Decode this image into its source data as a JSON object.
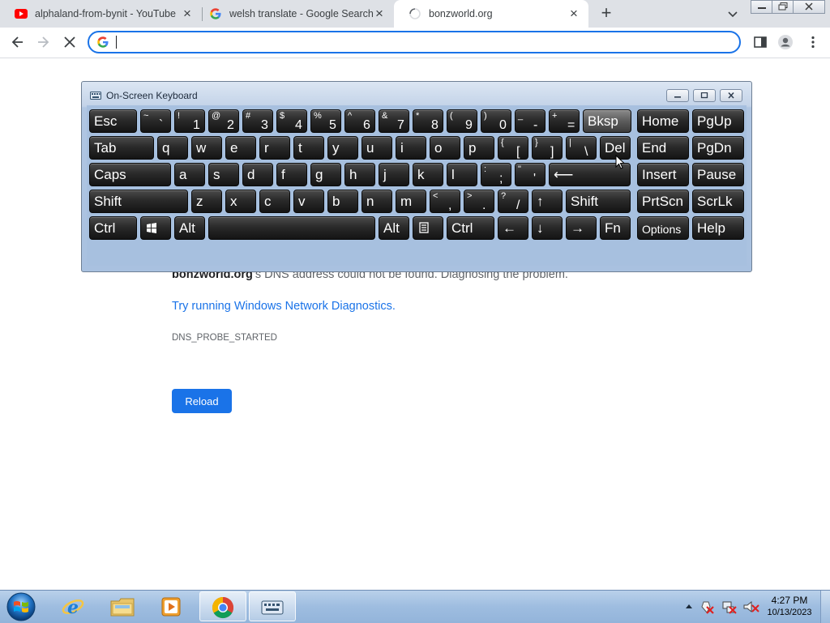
{
  "tabs": [
    {
      "title": "alphaland-from-bynit - YouTube",
      "favicon": "youtube-icon"
    },
    {
      "title": "welsh translate - Google Search",
      "favicon": "google-icon"
    },
    {
      "title": "bonzworld.org",
      "favicon": "loading-spinner-icon"
    }
  ],
  "omnibox": {
    "value": "",
    "placeholder": ""
  },
  "error_page": {
    "host": "bonzworld.org",
    "message": "’s DNS address could not be found. Diagnosing the problem.",
    "link": "Try running Windows Network Diagnostics.",
    "code": "DNS_PROBE_STARTED",
    "reload_label": "Reload"
  },
  "osk": {
    "title": "On-Screen Keyboard",
    "rows": [
      [
        {
          "label": "Esc"
        },
        {
          "shift": "~",
          "base": "`"
        },
        {
          "shift": "!",
          "base": "1"
        },
        {
          "shift": "@",
          "base": "2"
        },
        {
          "shift": "#",
          "base": "3"
        },
        {
          "shift": "$",
          "base": "4"
        },
        {
          "shift": "%",
          "base": "5"
        },
        {
          "shift": "^",
          "base": "6"
        },
        {
          "shift": "&",
          "base": "7"
        },
        {
          "shift": "*",
          "base": "8"
        },
        {
          "shift": "(",
          "base": "9"
        },
        {
          "shift": ")",
          "base": "0"
        },
        {
          "shift": "_",
          "base": "-"
        },
        {
          "shift": "+",
          "base": "="
        },
        {
          "label": "Bksp"
        },
        {
          "label": "Home"
        },
        {
          "label": "PgUp"
        }
      ],
      [
        {
          "label": "Tab"
        },
        {
          "label": "q"
        },
        {
          "label": "w"
        },
        {
          "label": "e"
        },
        {
          "label": "r"
        },
        {
          "label": "t"
        },
        {
          "label": "y"
        },
        {
          "label": "u"
        },
        {
          "label": "i"
        },
        {
          "label": "o"
        },
        {
          "label": "p"
        },
        {
          "shift": "{",
          "base": "["
        },
        {
          "shift": "}",
          "base": "]"
        },
        {
          "shift": "|",
          "base": "\\"
        },
        {
          "label": "Del"
        },
        {
          "label": "End"
        },
        {
          "label": "PgDn"
        }
      ],
      [
        {
          "label": "Caps"
        },
        {
          "label": "a"
        },
        {
          "label": "s"
        },
        {
          "label": "d"
        },
        {
          "label": "f"
        },
        {
          "label": "g"
        },
        {
          "label": "h"
        },
        {
          "label": "j"
        },
        {
          "label": "k"
        },
        {
          "label": "l"
        },
        {
          "shift": ":",
          "base": ";"
        },
        {
          "shift": "\"",
          "base": "'"
        },
        {
          "label": "⟵"
        },
        {
          "label": "Insert"
        },
        {
          "label": "Pause"
        }
      ],
      [
        {
          "label": "Shift"
        },
        {
          "label": "z"
        },
        {
          "label": "x"
        },
        {
          "label": "c"
        },
        {
          "label": "v"
        },
        {
          "label": "b"
        },
        {
          "label": "n"
        },
        {
          "label": "m"
        },
        {
          "shift": "<",
          "base": ","
        },
        {
          "shift": ">",
          "base": "."
        },
        {
          "shift": "?",
          "base": "/"
        },
        {
          "label": "↑"
        },
        {
          "label": "Shift"
        },
        {
          "label": "PrtScn"
        },
        {
          "label": "ScrLk"
        }
      ],
      [
        {
          "label": "Ctrl"
        },
        {
          "label": "",
          "icon": "windows-logo-icon"
        },
        {
          "label": "Alt"
        },
        {
          "label": ""
        },
        {
          "label": "Alt"
        },
        {
          "label": "",
          "icon": "menu-icon"
        },
        {
          "label": "Ctrl"
        },
        {
          "label": "←"
        },
        {
          "label": "↓"
        },
        {
          "label": "→"
        },
        {
          "label": "Fn"
        },
        {
          "label": "Options"
        },
        {
          "label": "Help"
        }
      ]
    ]
  },
  "taskbar": {
    "apps": [
      "internet-explorer-icon",
      "file-explorer-icon",
      "media-player-icon",
      "chrome-icon",
      "on-screen-keyboard-icon"
    ],
    "time": "4:27 PM",
    "date": "10/13/2023"
  },
  "colors": {
    "accent": "#1a73e8",
    "tab_strip": "#dee1e6",
    "taskbar": "#a4c2e3"
  }
}
